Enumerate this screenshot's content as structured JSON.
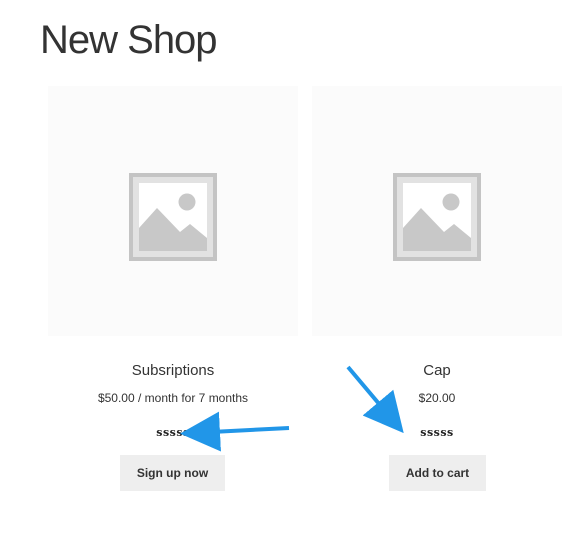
{
  "page": {
    "title": "New Shop"
  },
  "products": [
    {
      "name": "Subsriptions",
      "price": "$50.00 / month for 7 months",
      "custom_field": "sssss",
      "button_label": "Sign up now",
      "image": "placeholder-image-icon"
    },
    {
      "name": "Cap",
      "price": "$20.00",
      "custom_field": "sssss",
      "button_label": "Add to cart",
      "image": "placeholder-image-icon"
    }
  ],
  "annotations": {
    "arrow_color": "#2196e8"
  },
  "colors": {
    "button_bg": "#eeeeee",
    "text": "#333333",
    "placeholder_bg": "#fbfbfb",
    "placeholder_icon": "#c8c8c8"
  }
}
